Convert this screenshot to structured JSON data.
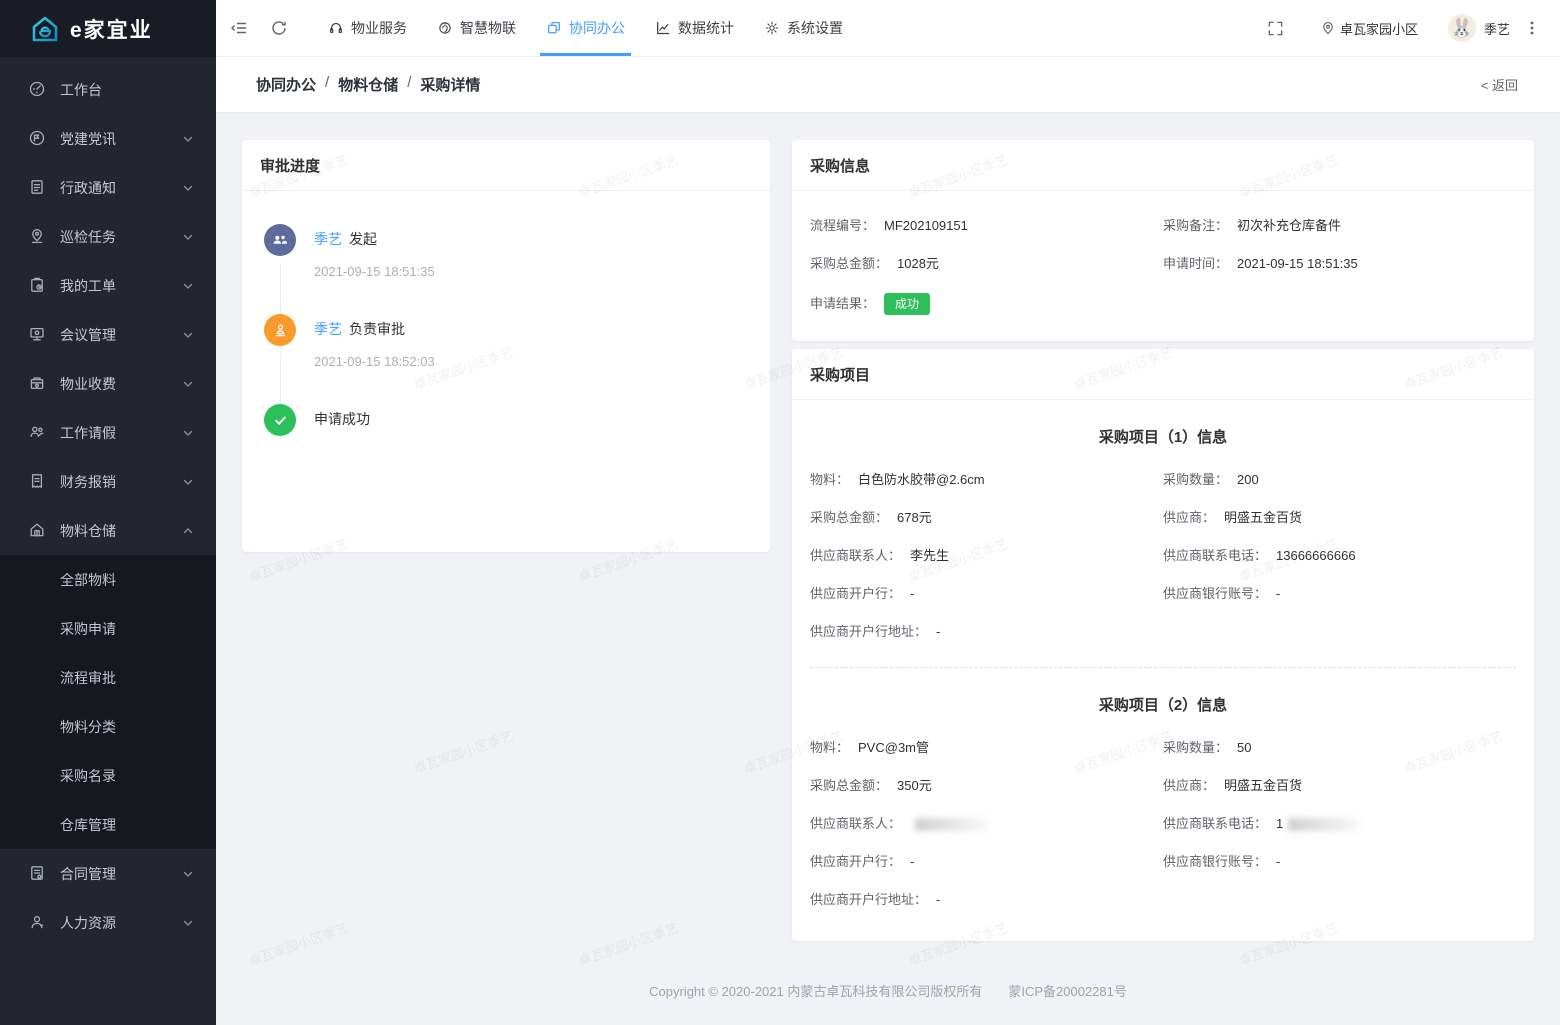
{
  "brand": {
    "name": "e家宜业"
  },
  "sidebar": {
    "items": [
      {
        "id": "workbench",
        "label": "工作台",
        "icon": "dashboard"
      },
      {
        "id": "party",
        "label": "党建党讯",
        "icon": "megaphone",
        "chevron": "down"
      },
      {
        "id": "notice",
        "label": "行政通知",
        "icon": "document",
        "chevron": "down"
      },
      {
        "id": "patrol",
        "label": "巡检任务",
        "icon": "pin",
        "chevron": "down"
      },
      {
        "id": "workorder",
        "label": "我的工单",
        "icon": "clipboard",
        "chevron": "down"
      },
      {
        "id": "meeting",
        "label": "会议管理",
        "icon": "monitor",
        "chevron": "down"
      },
      {
        "id": "fee",
        "label": "物业收费",
        "icon": "cashbox",
        "chevron": "down"
      },
      {
        "id": "leave",
        "label": "工作请假",
        "icon": "people",
        "chevron": "down"
      },
      {
        "id": "finance",
        "label": "财务报销",
        "icon": "receipt",
        "chevron": "down"
      },
      {
        "id": "warehouse",
        "label": "物料仓储",
        "icon": "house",
        "chevron": "up",
        "children": [
          {
            "id": "all-materials",
            "label": "全部物料"
          },
          {
            "id": "purchase-apply",
            "label": "采购申请"
          },
          {
            "id": "flow-approval",
            "label": "流程审批"
          },
          {
            "id": "material-category",
            "label": "物料分类"
          },
          {
            "id": "purchase-list",
            "label": "采购名录"
          },
          {
            "id": "warehouse-manage",
            "label": "仓库管理"
          }
        ]
      },
      {
        "id": "contract",
        "label": "合同管理",
        "icon": "contract",
        "chevron": "down"
      },
      {
        "id": "hr",
        "label": "人力资源",
        "icon": "person",
        "chevron": "down"
      }
    ]
  },
  "topbar": {
    "tabs": [
      {
        "id": "property",
        "label": "物业服务",
        "icon": "headset"
      },
      {
        "id": "iot",
        "label": "智慧物联",
        "icon": "chip"
      },
      {
        "id": "office",
        "label": "协同办公",
        "icon": "collab",
        "active": true
      },
      {
        "id": "stats",
        "label": "数据统计",
        "icon": "chart"
      },
      {
        "id": "settings",
        "label": "系统设置",
        "icon": "gear"
      }
    ],
    "community": "卓瓦家园小区",
    "user": "季艺",
    "avatar_emoji": "🐰"
  },
  "breadcrumb": {
    "parts": [
      "协同办公",
      "物料仓储",
      "采购详情"
    ],
    "separator": "/",
    "back": "< 返回"
  },
  "approval": {
    "title": "审批进度",
    "steps": [
      {
        "name": "季艺",
        "action": "发起",
        "time": "2021-09-15 18:51:35",
        "icon": "users",
        "color": "#5c6b9c"
      },
      {
        "name": "季艺",
        "action": "负责审批",
        "time": "2021-09-15 18:52:03",
        "icon": "stamp",
        "color": "#f99a2d"
      },
      {
        "action": "申请成功",
        "icon": "check",
        "color": "#2bc05a"
      }
    ]
  },
  "purchase_info": {
    "title": "采购信息",
    "fields": [
      {
        "label": "流程编号：",
        "value": "MF202109151"
      },
      {
        "label": "采购备注：",
        "value": "初次补充仓库备件"
      },
      {
        "label": "采购总金额：",
        "value": "1028元"
      },
      {
        "label": "申请时间：",
        "value": "2021-09-15 18:51:35"
      },
      {
        "label": "申请结果：",
        "value": "成功",
        "badge": true
      }
    ]
  },
  "purchase_items": {
    "title": "采购项目",
    "sections": [
      {
        "heading": "采购项目（1）信息",
        "fields": [
          {
            "label": "物料：",
            "value": "白色防水胶带@2.6cm"
          },
          {
            "label": "采购数量：",
            "value": "200"
          },
          {
            "label": "采购总金额：",
            "value": "678元"
          },
          {
            "label": "供应商：",
            "value": "明盛五金百货"
          },
          {
            "label": "供应商联系人：",
            "value": "李先生"
          },
          {
            "label": "供应商联系电话：",
            "value": "13666666666"
          },
          {
            "label": "供应商开户行：",
            "value": "-"
          },
          {
            "label": "供应商银行账号：",
            "value": "-"
          },
          {
            "label": "供应商开户行地址：",
            "value": "-"
          }
        ]
      },
      {
        "heading": "采购项目（2）信息",
        "fields": [
          {
            "label": "物料：",
            "value": "PVC@3m管"
          },
          {
            "label": "采购数量：",
            "value": "50"
          },
          {
            "label": "采购总金额：",
            "value": "350元"
          },
          {
            "label": "供应商：",
            "value": "明盛五金百货"
          },
          {
            "label": "供应商联系人：",
            "value": "",
            "redacted": true
          },
          {
            "label": "供应商联系电话：",
            "value": "1",
            "redacted": true
          },
          {
            "label": "供应商开户行：",
            "value": "-"
          },
          {
            "label": "供应商银行账号：",
            "value": "-"
          },
          {
            "label": "供应商开户行地址：",
            "value": "-"
          }
        ]
      }
    ]
  },
  "footer": {
    "text": "Copyright © 2020-2021 内蒙古卓瓦科技有限公司版权所有",
    "icp": "蒙ICP备20002281号"
  },
  "watermark": {
    "text": "卓瓦家园小区季艺"
  },
  "colors": {
    "accent": "#409eff",
    "badge_green": "#2fbe5c",
    "step_blue": "#5c6b9c",
    "step_orange": "#f99a2d",
    "step_green": "#2bc05a"
  }
}
